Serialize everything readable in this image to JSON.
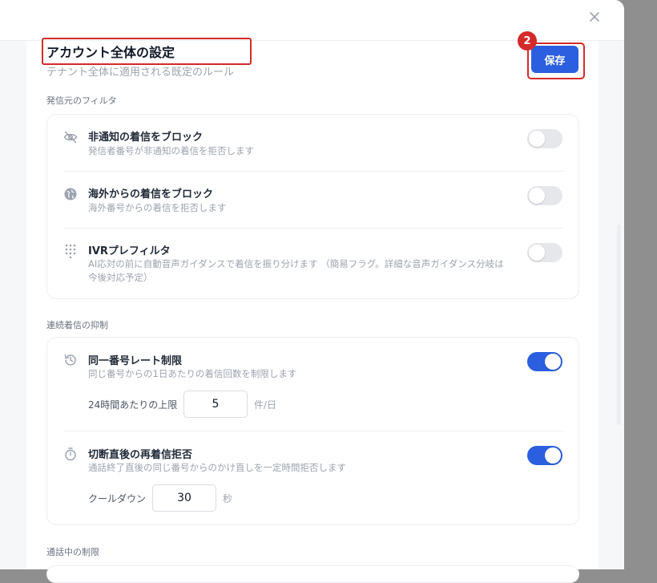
{
  "header": {
    "title": "アカウント全体の設定",
    "subtitle": "テナント全体に適用される既定のルール",
    "save_label": "保存",
    "step_badge": "2",
    "close_icon": "close-icon"
  },
  "sections": {
    "caller_filter": {
      "label": "発信元のフィルタ",
      "rows": [
        {
          "title": "非通知の着信をブロック",
          "desc": "発信者番号が非通知の着信を拒否します",
          "icon": "eye-off-icon",
          "enabled": false
        },
        {
          "title": "海外からの着信をブロック",
          "desc": "海外番号からの着信を拒否します",
          "icon": "globe-icon",
          "enabled": false
        },
        {
          "title": "IVRプレフィルタ",
          "desc": "AI応対の前に自動音声ガイダンスで着信を振り分けます （簡易フラグ。詳細な音声ガイダンス分岐は今後対応予定）",
          "icon": "dialpad-icon",
          "enabled": false
        }
      ]
    },
    "repeat_suppression": {
      "label": "連続着信の抑制",
      "rows": [
        {
          "title": "同一番号レート制限",
          "desc": "同じ番号からの1日あたりの着信回数を制限します",
          "icon": "history-icon",
          "enabled": true,
          "field_label": "24時間あたりの上限",
          "field_value": "5",
          "field_unit": "件/日"
        },
        {
          "title": "切断直後の再着信拒否",
          "desc": "通話終了直後の同じ番号からのかけ直しを一定時間拒否します",
          "icon": "timer-icon",
          "enabled": true,
          "field_label": "クールダウン",
          "field_value": "30",
          "field_unit": "秒"
        }
      ]
    },
    "in_call": {
      "label": "通話中の制限"
    }
  },
  "colors": {
    "accent": "#2b5fe0",
    "highlight": "#d42a2a"
  }
}
